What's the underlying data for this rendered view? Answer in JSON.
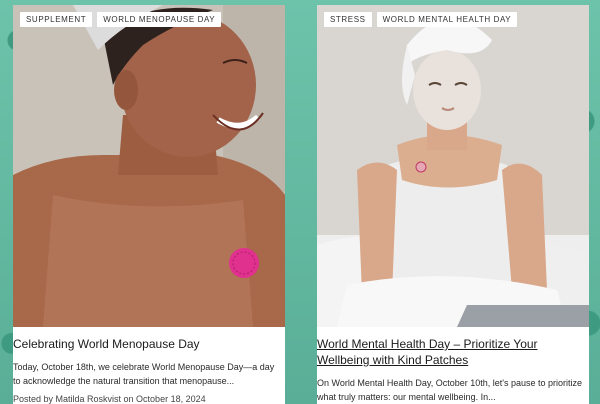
{
  "cards": [
    {
      "tags": [
        "SUPPLEMENT",
        "WORLD MENOPAUSE DAY"
      ],
      "title": "Celebrating World Menopause Day",
      "excerpt": "Today, October 18th, we celebrate World Menopause Day—a day to acknowledge the natural transition that menopause...",
      "meta": "Posted by Matilda Roskvist on October 18, 2024",
      "image": "woman-smiling-with-pink-patch"
    },
    {
      "tags": [
        "STRESS",
        "WORLD MENTAL HEALTH DAY"
      ],
      "title": "World Mental Health Day – Prioritize Your Wellbeing with Kind Patches",
      "excerpt": "On World Mental Health Day, October 10th, let's pause to prioritize what truly matters: our mental wellbeing. In...",
      "image": "woman-face-mask-with-laptop"
    }
  ],
  "colors": {
    "background": "#5fb8a0",
    "patch": "#e0318f"
  }
}
